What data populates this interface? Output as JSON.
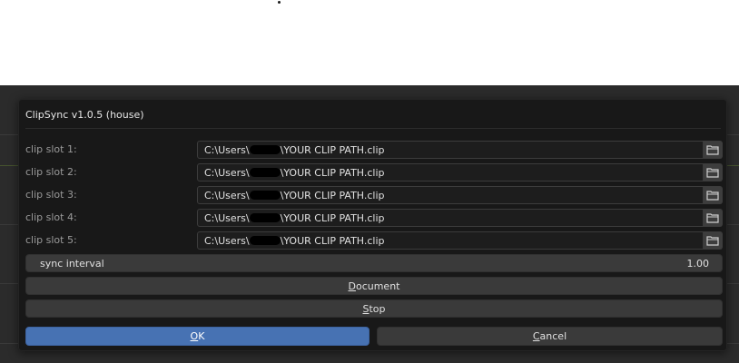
{
  "dialog": {
    "title": "ClipSync v1.0.5 (house)",
    "slots": [
      {
        "label": "clip slot 1:",
        "prefix": "C:\\Users\\",
        "suffix": "\\YOUR CLIP PATH.clip"
      },
      {
        "label": "clip slot 2:",
        "prefix": "C:\\Users\\",
        "suffix": "\\YOUR CLIP PATH.clip"
      },
      {
        "label": "clip slot 3:",
        "prefix": "C:\\Users\\",
        "suffix": "\\YOUR CLIP PATH.clip"
      },
      {
        "label": "clip slot 4:",
        "prefix": "C:\\Users\\",
        "suffix": "\\YOUR CLIP PATH.clip"
      },
      {
        "label": "clip slot 5:",
        "prefix": "C:\\Users\\",
        "suffix": "\\YOUR CLIP PATH.clip"
      }
    ],
    "folder_icon": "folder-icon",
    "sync": {
      "label": "sync interval",
      "value": "1.00"
    },
    "document_button": {
      "first": "D",
      "rest": "ocument"
    },
    "stop_button": {
      "first": "S",
      "rest": "top"
    },
    "ok_button": {
      "first": "O",
      "rest": "K"
    },
    "cancel_button": {
      "first": "C",
      "rest": "ancel"
    }
  },
  "colors": {
    "dialog_bg": "#181818",
    "editor_bg": "#2b2b2b",
    "field_bg": "#1d1d1d",
    "button_bg": "#3a3a3a",
    "accent": "#4772b3"
  }
}
